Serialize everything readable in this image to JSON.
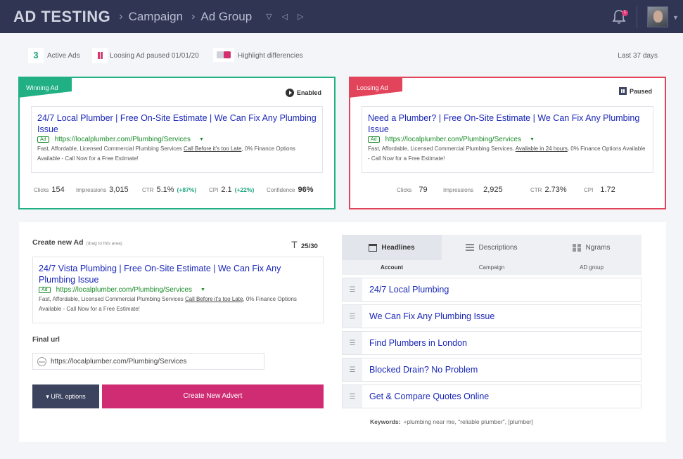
{
  "header": {
    "brand": "AD TESTING",
    "crumbs": [
      "Campaign",
      "Ad Group"
    ],
    "notifications": "1"
  },
  "status": {
    "active_count": "3",
    "active_label": "Active Ads",
    "paused_label": "Loosing Ad paused 01/01/20",
    "highlight_label": "Highlight differencies",
    "period": "Last 37 days"
  },
  "winning": {
    "ribbon": "Winning Ad",
    "state": "Enabled",
    "headline": "24/7 Local Plumber | Free On-Site Estimate | We Can Fix Any Plumbing Issue",
    "tag": "Ad",
    "url": "https://localplumber.com/Plumbing/Services",
    "desc_pre": "Fast, Affordable, Licensed Commercial Plumbing Services ",
    "desc_link": "Call Before it's too Late",
    "desc_post": ", 0% Finance Options Available - Call Now for a Free Estimate!",
    "metrics": {
      "clicks_label": "Clicks",
      "clicks": "154",
      "impr_label": "Impressions",
      "impr": "3,015",
      "ctr_label": "CTR",
      "ctr": "5.1%",
      "ctr_delta": "(+87%)",
      "cpi_label": "CPI",
      "cpi": "2.1",
      "cpi_delta": "(+22%)",
      "conf_label": "Confidence",
      "conf": "96%"
    }
  },
  "losing": {
    "ribbon": "Loosing Ad",
    "state": "Paused",
    "headline": "Need a Plumber? | Free On-Site Estimate | We Can Fix Any Plumbing Issue",
    "tag": "Ad",
    "url": "https://localplumber.com/Plumbing/Services",
    "desc_pre": "Fast, Affordable, Licensed Commercial Plumbing Services. ",
    "desc_link": "Available in 24 hours",
    "desc_post": ", 0% Finance Options Available - Call Now for a Free Estimate!",
    "metrics": {
      "clicks_label": "Clicks",
      "clicks": "79",
      "impr_label": "Impressions",
      "impr": "2,925",
      "ctr_label": "CTR",
      "ctr": "2.73%",
      "cpi_label": "CPI",
      "cpi": "1.72"
    }
  },
  "create": {
    "title": "Create new Ad",
    "hint": "(drag to this area)",
    "counter": "25/30",
    "headline": "24/7 Vista Plumbing | Free On-Site Estimate | We Can Fix Any Plumbing Issue",
    "tag": "Ad",
    "url": "https://localplumber.com/Plumbing/Services",
    "desc_pre": "Fast, Affordable, Licensed Commercial Plumbing Services ",
    "desc_link": "Call Before it's too Late",
    "desc_post": ", 0% Finance Options Available - Call Now for a Free Estimate!",
    "final_url_label": "Final url",
    "www": "www",
    "final_url": "https://localplumber.com/Plumbing/Services",
    "url_options": "▾ URL options",
    "create_button": "Create New Advert"
  },
  "library": {
    "tabs": [
      "Headlines",
      "Descriptions",
      "Ngrams"
    ],
    "subtabs": [
      "Account",
      "Campaign",
      "AD group"
    ],
    "items": [
      "24/7 Local Plumbing",
      "We Can Fix Any Plumbing Issue",
      "Find Plumbers in London",
      "Blocked Drain? No Problem",
      "Get & Compare Quotes Online"
    ],
    "keywords_label": "Keywords:",
    "keywords": "+plumbing near me, \"reliable plumber\", [plumber]"
  }
}
